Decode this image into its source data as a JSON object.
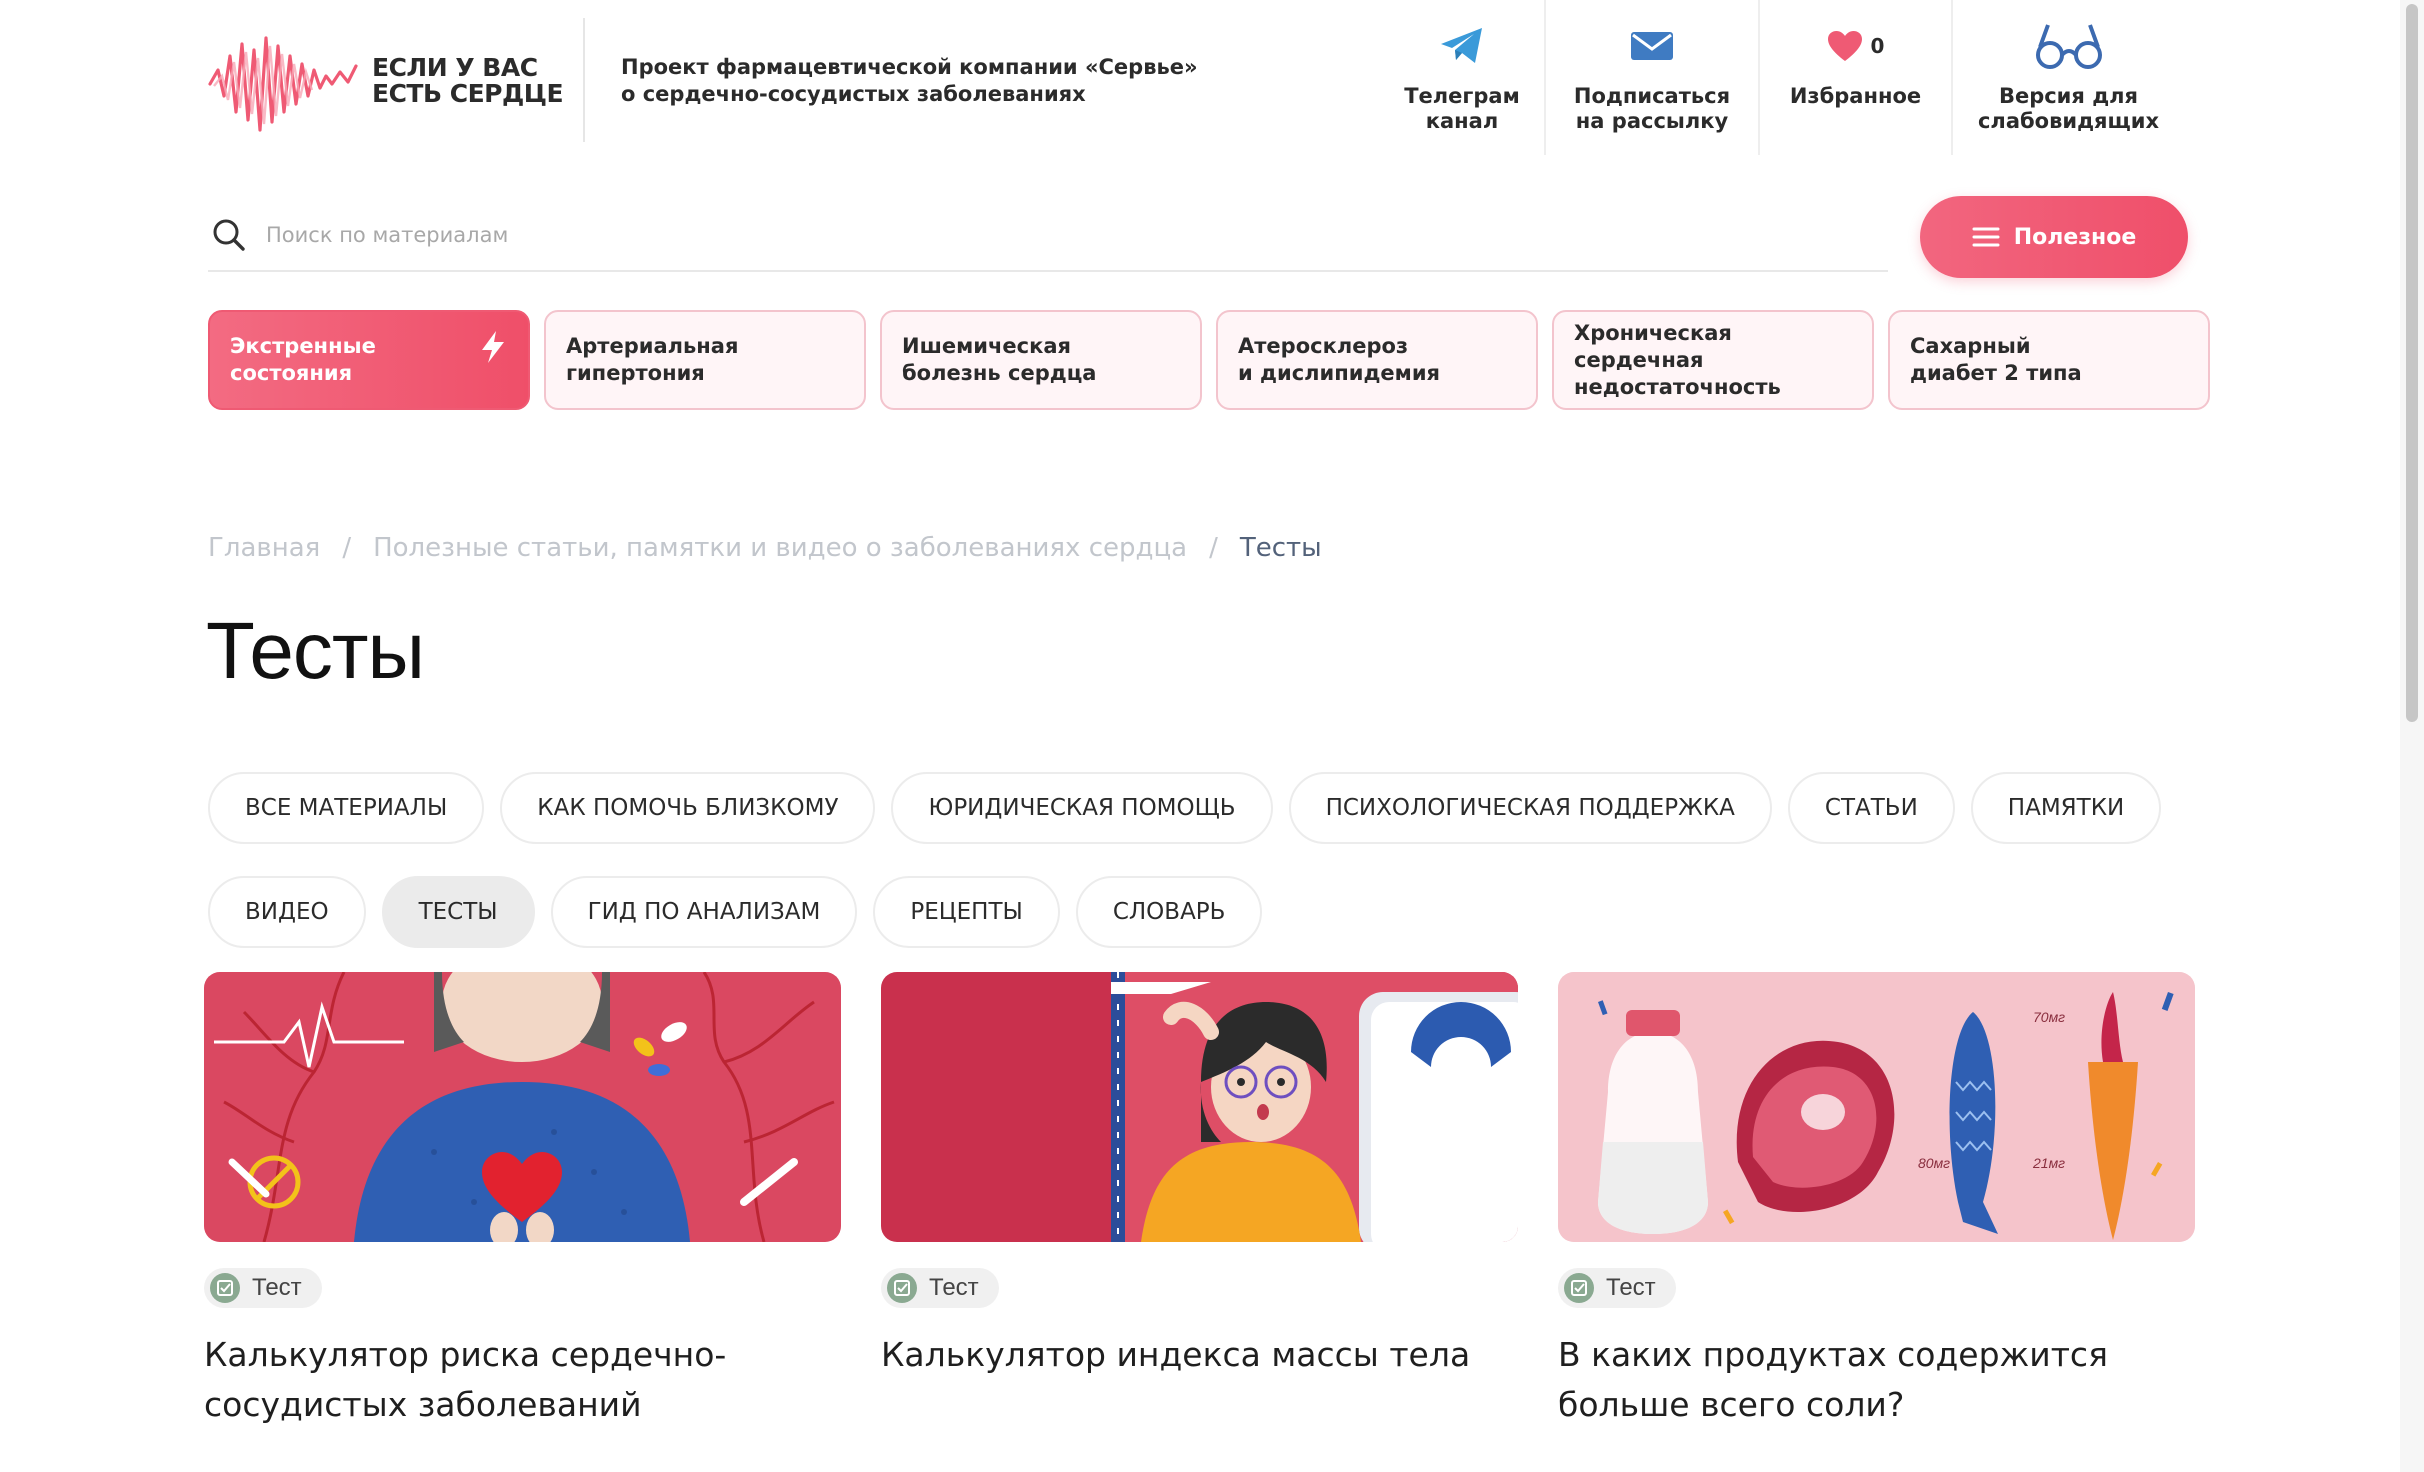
{
  "header": {
    "logo_lines": [
      "ЕСЛИ У ВАС",
      "ЕСТЬ СЕРДЦЕ"
    ],
    "tagline_lines": [
      "Проект фармацевтической компании «Сервье»",
      "о сердечно-сосудистых заболеваниях"
    ],
    "actions": [
      {
        "icon": "telegram-icon",
        "lines": [
          "Телеграм",
          "канал"
        ]
      },
      {
        "icon": "mail-icon",
        "lines": [
          "Подписаться",
          "на рассылку"
        ]
      },
      {
        "icon": "heart-icon",
        "lines": [
          "Избранное"
        ],
        "count": "0"
      },
      {
        "icon": "glasses-icon",
        "lines": [
          "Версия для",
          "слабовидящих"
        ]
      }
    ]
  },
  "search": {
    "placeholder": "Поиск по материалам",
    "button_label": "Полезное"
  },
  "categories": [
    {
      "lines": [
        "Экстренные",
        "состояния"
      ],
      "active": true,
      "icon": "lightning-icon"
    },
    {
      "lines": [
        "Артериальная",
        "гипертония"
      ]
    },
    {
      "lines": [
        "Ишемическая",
        "болезнь сердца"
      ]
    },
    {
      "lines": [
        "Атеросклероз",
        "и дислипидемия"
      ]
    },
    {
      "lines": [
        "Хроническая сердечная",
        "недостаточность"
      ]
    },
    {
      "lines": [
        "Сахарный",
        "диабет 2 типа"
      ]
    }
  ],
  "breadcrumb": {
    "items": [
      "Главная",
      "Полезные статьи, памятки и видео о заболеваниях сердца"
    ],
    "separator": "/",
    "current": "Тесты"
  },
  "page_title": "Тесты",
  "filters": [
    "ВСЕ МАТЕРИАЛЫ",
    "КАК ПОМОЧЬ БЛИЗКОМУ",
    "ЮРИДИЧЕСКАЯ ПОМОЩЬ",
    "ПСИХОЛОГИЧЕСКАЯ ПОДДЕРЖКА",
    "СТАТЬИ",
    "ПАМЯТКИ",
    "ВИДЕО",
    "ТЕСТЫ",
    "ГИД ПО АНАЛИЗАМ",
    "РЕЦЕПТЫ",
    "СЛОВАРЬ"
  ],
  "active_filter": "ТЕСТЫ",
  "cards": [
    {
      "badge": "Тест",
      "title": "Калькулятор риска сердечно-сосудистых заболеваний",
      "image": "heart-risk-illustration"
    },
    {
      "badge": "Тест",
      "title": "Калькулятор индекса массы тела",
      "image": "bmi-illustration"
    },
    {
      "badge": "Тест",
      "title": "В каких продуктах содержится больше всего соли?",
      "image": "salt-foods-illustration",
      "image_labels": [
        "70мг",
        "80мг",
        "21мг"
      ]
    }
  ],
  "colors": {
    "accent": "#ef4f6a",
    "tile_bg": "#fff5f7",
    "tile_border": "#f3c4cd",
    "telegram": "#3a9ad9",
    "mail": "#3f7bc2",
    "glasses": "#3c6ab0",
    "badge_icon": "#8aa991"
  }
}
